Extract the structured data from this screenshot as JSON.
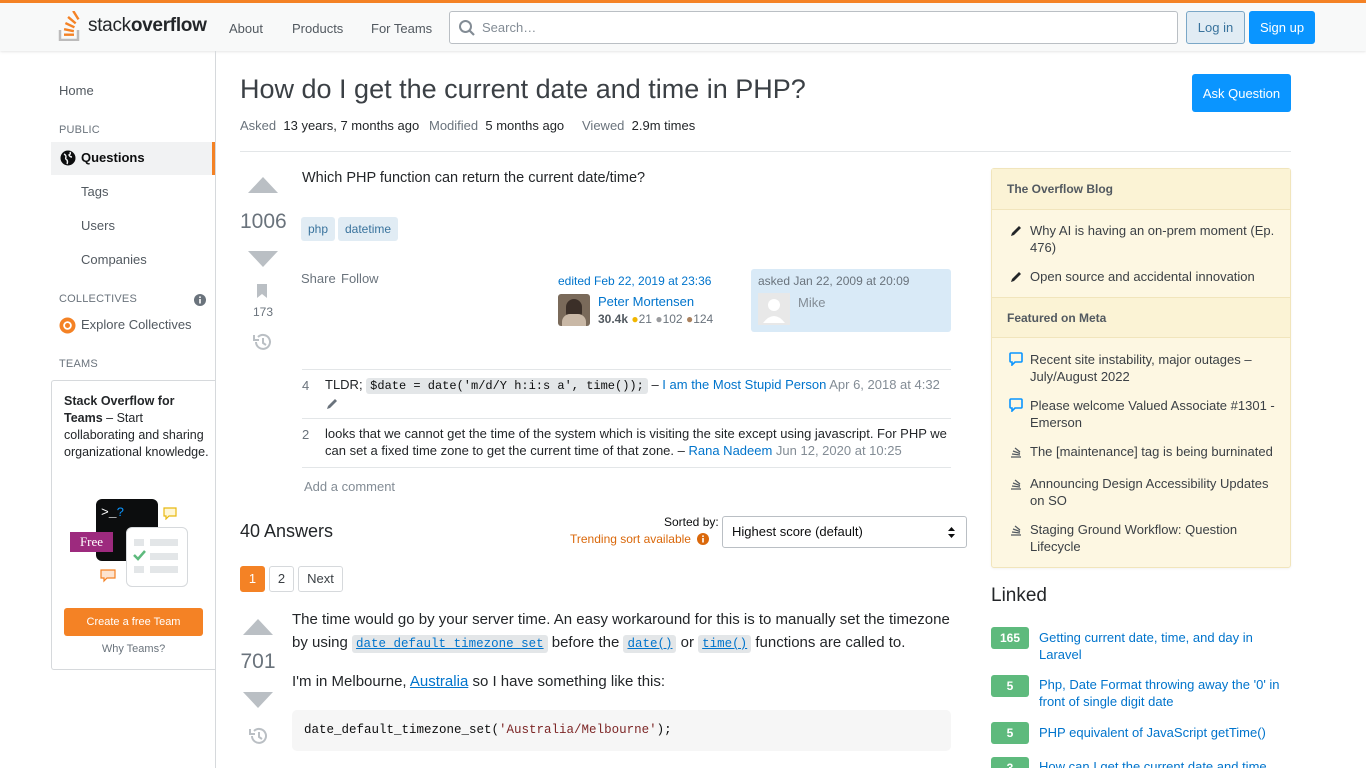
{
  "topbar": {
    "logo_light": "stack",
    "logo_bold": "overflow",
    "nav": [
      "About",
      "Products",
      "For Teams"
    ],
    "search_placeholder": "Search…",
    "login": "Log in",
    "signup": "Sign up"
  },
  "sidebar": {
    "home": "Home",
    "public_heading": "PUBLIC",
    "questions": "Questions",
    "tags": "Tags",
    "users": "Users",
    "companies": "Companies",
    "collectives_heading": "COLLECTIVES",
    "explore_collectives": "Explore Collectives",
    "teams_heading": "TEAMS",
    "teams_title": "Stack Overflow for Teams",
    "teams_desc": " – Start collaborating and sharing organizational knowledge.",
    "free_badge": "Free",
    "create_team": "Create a free Team",
    "why_teams": "Why Teams?"
  },
  "question": {
    "title": "How do I get the current date and time in PHP?",
    "asked_label": "Asked",
    "asked_value": "13 years, 7 months ago",
    "modified_label": "Modified",
    "modified_value": "5 months ago",
    "viewed_label": "Viewed",
    "viewed_value": "2.9m times",
    "ask_button": "Ask Question",
    "votes": "1006",
    "bookmarks": "173",
    "body": "Which PHP function can return the current date/time?",
    "tags": [
      "php",
      "datetime"
    ],
    "share": "Share",
    "follow": "Follow",
    "edited": "edited Feb 22, 2019 at 23:36",
    "editor_name": "Peter Mortensen",
    "editor_rep": "30.4k",
    "editor_gold": "21",
    "editor_silver": "102",
    "editor_bronze": "124",
    "asked_card": "asked Jan 22, 2009 at 20:09",
    "asker_name": "Mike"
  },
  "comments": [
    {
      "score": "4",
      "prefix": "TLDR; ",
      "code": "$date = date('m/d/Y h:i:s a', time());",
      "dash": " – ",
      "user": "I am the Most Stupid Person",
      "date": " Apr 6, 2018 at 4:32"
    },
    {
      "score": "2",
      "text": "looks that we cannot get the time of the system which is visiting the site except using javascript. For PHP we can set a fixed time zone to get the current time of that zone. – ",
      "user": "Rana Nadeem",
      "date": " Jun 12, 2020 at 10:25"
    }
  ],
  "add_comment": "Add a comment",
  "answers": {
    "count_label": "40 Answers",
    "sorted_by": "Sorted by:",
    "trending": "Trending sort available",
    "sort_value": "Highest score (default)",
    "pages": [
      "1",
      "2",
      "Next"
    ]
  },
  "answer": {
    "votes": "701",
    "p1_a": "The time would go by your server time. An easy workaround for this is to manually set the timezone by using ",
    "p1_code1": "date_default_timezone_set",
    "p1_b": " before the ",
    "p1_code2": "date()",
    "p1_c": " or ",
    "p1_code3": "time()",
    "p1_d": " functions are called to.",
    "p2_a": "I'm in Melbourne, ",
    "p2_link": "Australia",
    "p2_b": " so I have something like this:",
    "code_fn": "date_default_timezone_set(",
    "code_str": "'Australia/Melbourne'",
    "code_end": ");"
  },
  "blog": {
    "heading": "The Overflow Blog",
    "items": [
      "Why AI is having an on-prem moment (Ep. 476)",
      "Open source and accidental innovation"
    ],
    "meta_heading": "Featured on Meta",
    "meta_items": [
      "Recent site instability, major outages – July/August 2022",
      "Please welcome Valued Associate #1301 - Emerson",
      "The [maintenance] tag is being burninated",
      "Announcing Design Accessibility Updates on SO",
      "Staging Ground Workflow: Question Lifecycle"
    ]
  },
  "linked": {
    "heading": "Linked",
    "items": [
      {
        "score": "165",
        "title": "Getting current date, time, and day in Laravel"
      },
      {
        "score": "5",
        "title": "Php, Date Format throwing away the '0' in front of single digit date"
      },
      {
        "score": "5",
        "title": "PHP equivalent of JavaScript getTime()"
      },
      {
        "score": "3",
        "title": "How can I get the current date and time"
      }
    ]
  },
  "colors": {
    "accent": "#f48225",
    "link": "#0074cc",
    "primary_button": "#0a95ff",
    "answer_score": "#5eba7d"
  }
}
